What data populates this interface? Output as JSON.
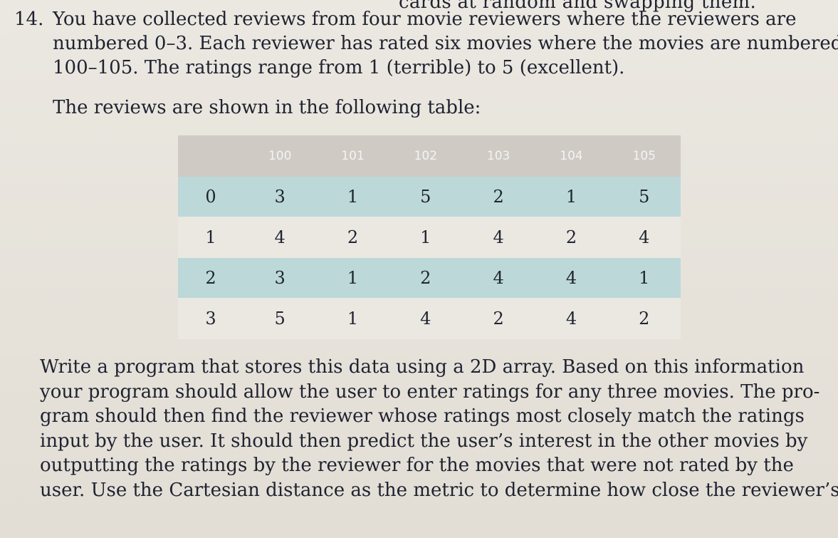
{
  "previous_text_tail": "cards at random and swapping them.",
  "problem": {
    "number": "14.",
    "lines": [
      "You have collected reviews from four movie reviewers where the reviewers are",
      "numbered 0–3. Each reviewer has rated six movies where the movies are numbered",
      "100–105. The ratings range from 1 (terrible) to 5 (excellent)."
    ],
    "intro": "The reviews are shown in the following table:"
  },
  "table": {
    "headers": [
      "",
      "100",
      "101",
      "102",
      "103",
      "104",
      "105"
    ],
    "rows": [
      [
        "0",
        "3",
        "1",
        "5",
        "2",
        "1",
        "5"
      ],
      [
        "1",
        "4",
        "2",
        "1",
        "4",
        "2",
        "4"
      ],
      [
        "2",
        "3",
        "1",
        "2",
        "4",
        "4",
        "1"
      ],
      [
        "3",
        "5",
        "1",
        "4",
        "2",
        "4",
        "2"
      ]
    ]
  },
  "body": {
    "lines": [
      "Write a program that stores this data using a 2D array. Based on this information",
      "your program should allow the user to enter ratings for any three movies. The pro-",
      "gram should then find the reviewer whose ratings most closely match the ratings",
      "input by the user. It should then predict the user’s interest in the other movies by",
      "outputting the ratings by the reviewer for the movies that were not rated by the",
      "user. Use the Cartesian distance as the metric to determine how close the reviewer’s"
    ]
  }
}
